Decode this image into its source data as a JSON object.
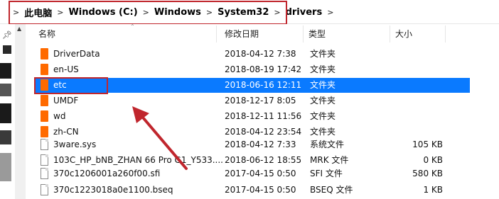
{
  "breadcrumb": [
    "此电脑",
    "Windows (C:)",
    "Windows",
    "System32",
    "drivers"
  ],
  "breadcrumb_separator": ">",
  "columns": {
    "name": "名称",
    "modified": "修改日期",
    "type": "类型",
    "size": "大小"
  },
  "rows": [
    {
      "name": "DriverData",
      "modified": "2018-04-12 7:38",
      "type": "文件夹",
      "size": "",
      "icon": "folder-icon"
    },
    {
      "name": "en-US",
      "modified": "2018-08-19 17:42",
      "type": "文件夹",
      "size": "",
      "icon": "folder-icon"
    },
    {
      "name": "etc",
      "modified": "2018-06-16 12:11",
      "type": "文件夹",
      "size": "",
      "icon": "folder-icon",
      "selected": true
    },
    {
      "name": "UMDF",
      "modified": "2018-12-17 8:05",
      "type": "文件夹",
      "size": "",
      "icon": "folder-icon"
    },
    {
      "name": "wd",
      "modified": "2018-12-11 11:56",
      "type": "文件夹",
      "size": "",
      "icon": "folder-icon"
    },
    {
      "name": "zh-CN",
      "modified": "2018-04-12 23:54",
      "type": "文件夹",
      "size": "",
      "icon": "folder-icon"
    },
    {
      "name": "3ware.sys",
      "modified": "2018-04-12 7:33",
      "type": "系统文件",
      "size": "105 KB",
      "icon": "file-icon"
    },
    {
      "name": "103C_HP_bNB_ZHAN 66 Pro G1_Y533....",
      "modified": "2018-06-12 18:55",
      "type": "MRK 文件",
      "size": "0 KB",
      "icon": "file-icon"
    },
    {
      "name": "370c1206001a260f00.sfi",
      "modified": "2017-04-15 0:50",
      "type": "SFI 文件",
      "size": "580 KB",
      "icon": "file-icon"
    },
    {
      "name": "370c1223018a0e1100.bseq",
      "modified": "2017-04-15 0:50",
      "type": "BSEQ 文件",
      "size": "1 KB",
      "icon": "file-icon"
    }
  ],
  "colors": {
    "selection": "#0a7aff",
    "annotation": "#c0262d",
    "folder": "#ff6a00"
  }
}
